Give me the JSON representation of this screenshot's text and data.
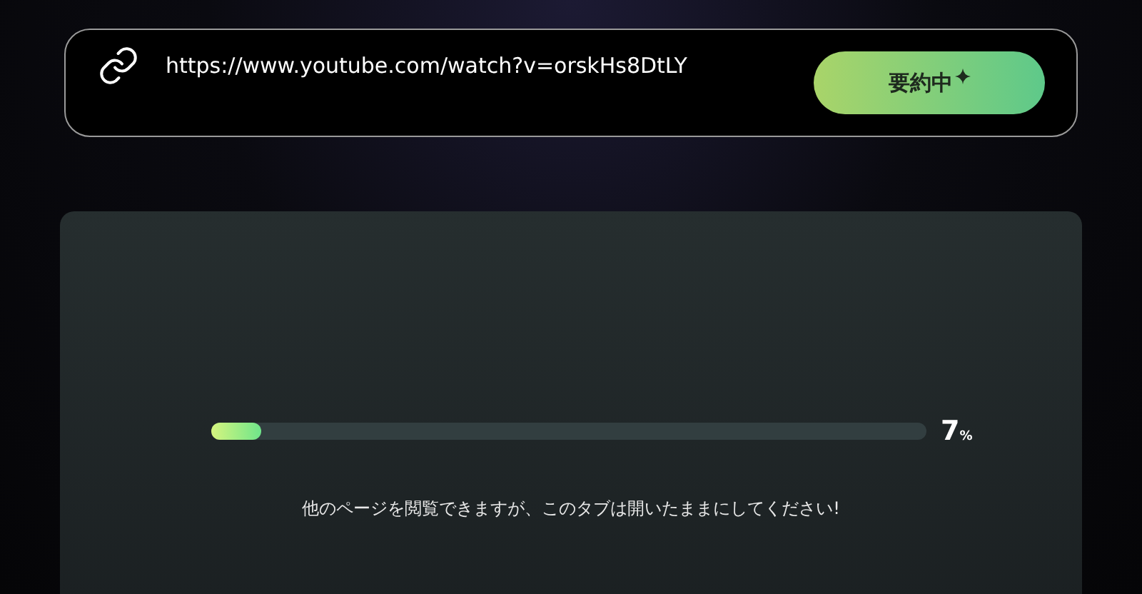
{
  "url_bar": {
    "value": "https://www.youtube.com/watch?v=orskHs8DtLY",
    "button": {
      "label": "要約中"
    }
  },
  "progress": {
    "level": 0.07,
    "value": "7",
    "unit": "%",
    "message": "他のページを閲覧できますが、このタブは開いたままにしてください!"
  }
}
